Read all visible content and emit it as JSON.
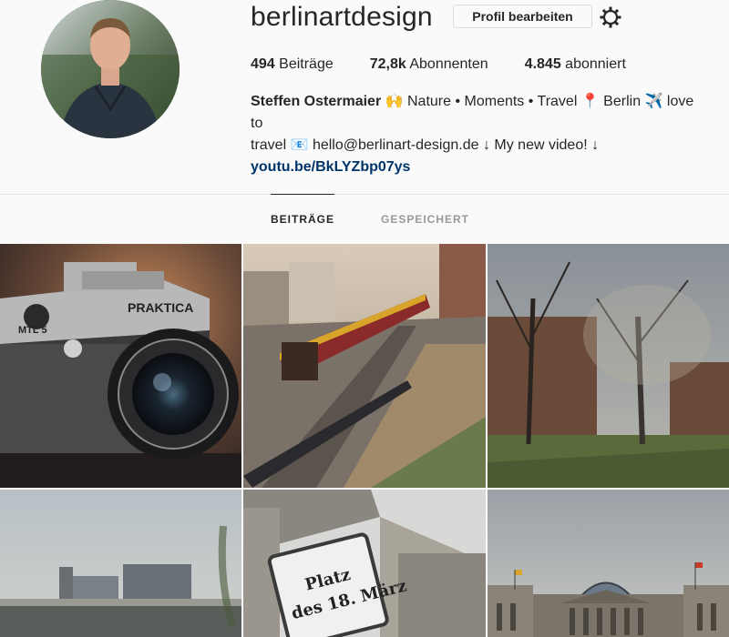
{
  "profile": {
    "username": "berlinartdesign",
    "edit_button": "Profil bearbeiten",
    "stats": [
      {
        "value": "494",
        "label": "Beiträge"
      },
      {
        "value": "72,8k",
        "label": "Abonnenten"
      },
      {
        "value": "4.845",
        "label": "abonniert"
      }
    ],
    "bio_name": "Steffen Ostermaier",
    "bio_line1": "🙌 Nature • Moments • Travel 📍 Berlin ✈️ love to",
    "bio_line2": "travel 📧 hello@berlinart-design.de ↓ My new video! ↓",
    "bio_link": "youtu.be/BkLYZbp07ys"
  },
  "tabs": [
    {
      "label": "BEITRÄGE",
      "active": true
    },
    {
      "label": "GESPEICHERT",
      "active": false
    }
  ],
  "posts": [
    {
      "subject": "camera",
      "text": [
        "PRAKTICA",
        "MTL 5"
      ]
    },
    {
      "subject": "train",
      "text": []
    },
    {
      "subject": "trees",
      "text": []
    },
    {
      "subject": "station",
      "text": []
    },
    {
      "subject": "sign",
      "text": [
        "Platz",
        "des 18. März"
      ]
    },
    {
      "subject": "reichstag",
      "text": []
    }
  ]
}
